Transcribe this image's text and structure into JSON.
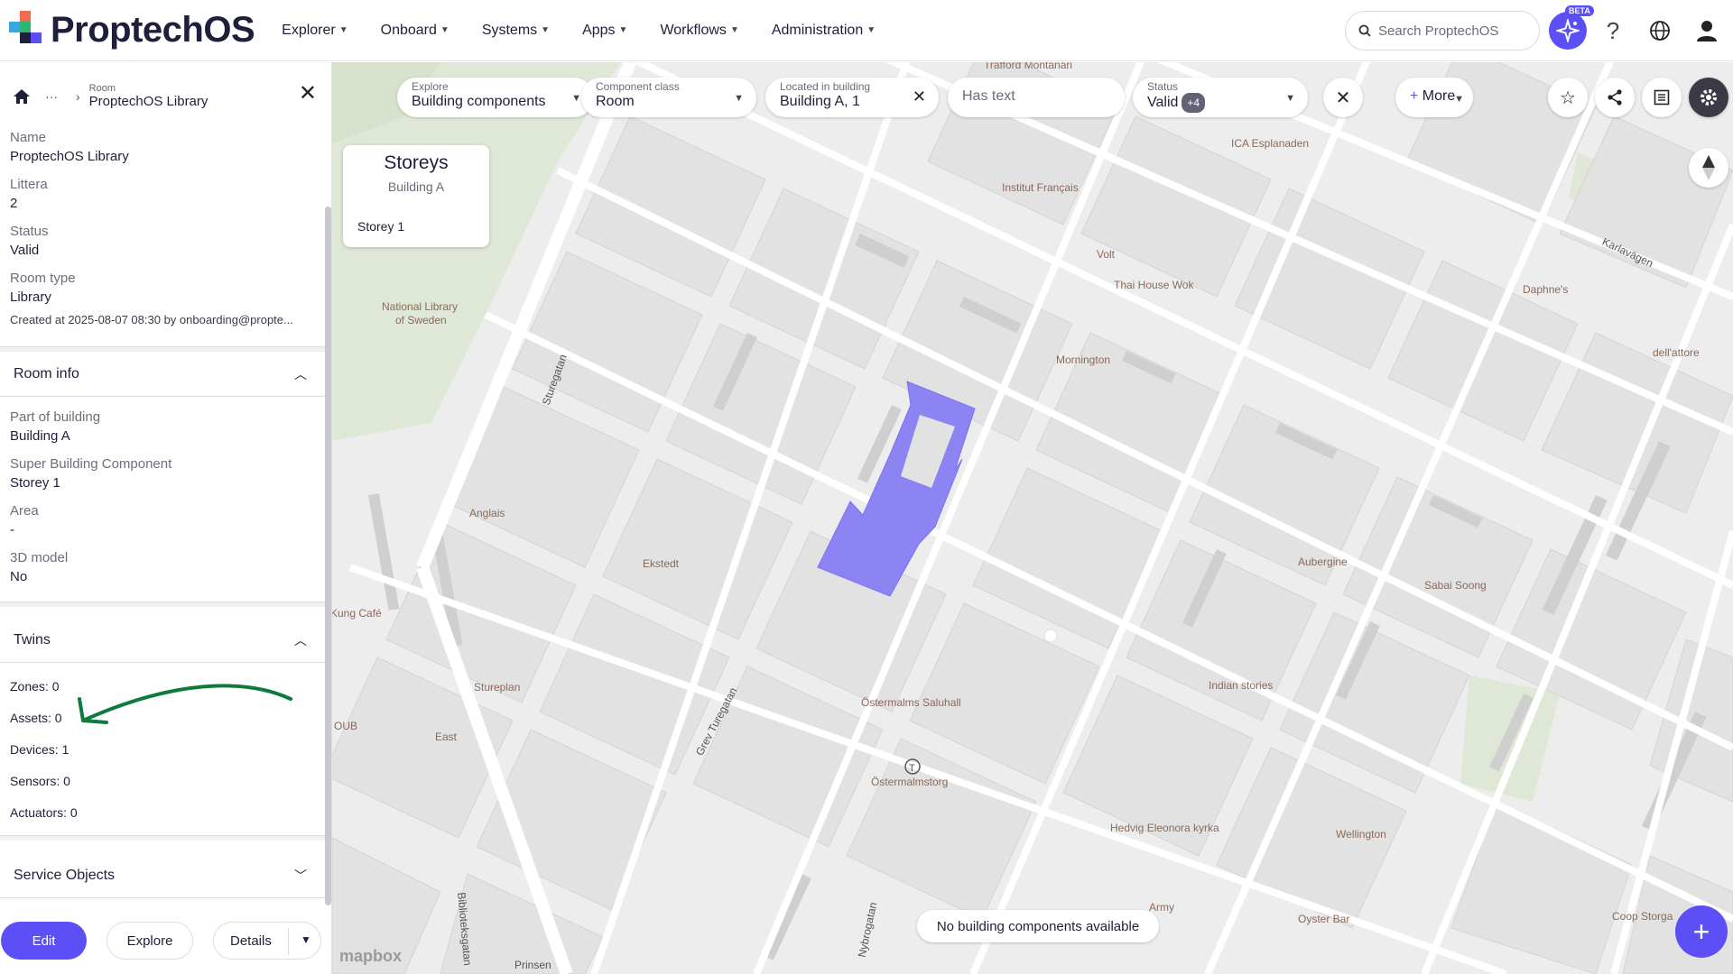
{
  "app": {
    "name": "ProptechOS",
    "beta": "BETA"
  },
  "nav": [
    {
      "label": "Explorer"
    },
    {
      "label": "Onboard"
    },
    {
      "label": "Systems"
    },
    {
      "label": "Apps"
    },
    {
      "label": "Workflows"
    },
    {
      "label": "Administration"
    }
  ],
  "search": {
    "placeholder": "Search ProptechOS"
  },
  "panel": {
    "breadcrumb": {
      "ellipsis": "···",
      "type": "Room",
      "title": "ProptechOS Library"
    },
    "fields": [
      {
        "label": "Name",
        "value": "ProptechOS Library"
      },
      {
        "label": "Littera",
        "value": "2"
      },
      {
        "label": "Status",
        "value": "Valid"
      },
      {
        "label": "Room type",
        "value": "Library"
      }
    ],
    "created": "Created at 2025-08-07 08:30 by onboarding@propte...",
    "room_info": {
      "title": "Room info",
      "fields": [
        {
          "label": "Part of building",
          "value": "Building A"
        },
        {
          "label": "Super Building Component",
          "value": "Storey 1"
        },
        {
          "label": "Area",
          "value": "-"
        },
        {
          "label": "3D model",
          "value": "No"
        }
      ]
    },
    "twins": {
      "title": "Twins",
      "items": [
        "Zones: 0",
        "Assets: 0",
        "Devices: 1",
        "Sensors: 0",
        "Actuators: 0"
      ]
    },
    "service_objects": {
      "title": "Service Objects"
    },
    "buttons": {
      "edit": "Edit",
      "explore": "Explore",
      "details": "Details"
    }
  },
  "filters": {
    "explore": {
      "label": "Explore",
      "value": "Building components"
    },
    "component_class": {
      "label": "Component class",
      "value": "Room"
    },
    "located_in": {
      "label": "Located in building",
      "value": "Building A, 1"
    },
    "has_text": {
      "placeholder": "Has text"
    },
    "status": {
      "label": "Status",
      "value": "Valid",
      "badge": "+4"
    },
    "more": "More"
  },
  "storeys": {
    "title": "Storeys",
    "subtitle": "Building A",
    "items": [
      "Storey 1"
    ]
  },
  "map": {
    "toast": "No building components available",
    "attribution": "mapbox",
    "labels": {
      "trafford": "Trafford Montanari",
      "ica": "ICA Esplanaden",
      "institut": "Institut Français",
      "volt": "Volt",
      "thai": "Thai House Wok",
      "daphne": "Daphne's",
      "karlavagen": "Karlavägen",
      "dellattore": "dell'attore",
      "library1": "National Library",
      "library2": "of Sweden",
      "mornington": "Mornington",
      "sturegatan": "Sturegatan",
      "anglais": "Anglais",
      "ekstedt": "Ekstedt",
      "aubergine": "Aubergine",
      "sabai": "Sabai Soong",
      "kungcafe": "Kung Café",
      "sturehof": "Stureplan",
      "grev": "Grev Turegatan",
      "saluhall": "Östermalms Saluhall",
      "ostermalmstorg": "Östermalmstorg",
      "indian": "Indian stories",
      "hedvig": "Hedvig Eleonora kyrka",
      "wellington": "Wellington",
      "east": "East",
      "oub": "OUB",
      "army": "Army",
      "oyster": "Oyster Bar",
      "coop": "Coop Storga",
      "biblio": "Biblioteksgatan",
      "nybro": "Nybrogatan",
      "prinsen": "Prinsen"
    }
  },
  "colors": {
    "accent": "#5b4ff5",
    "highlight_room": "#8c84f3"
  }
}
